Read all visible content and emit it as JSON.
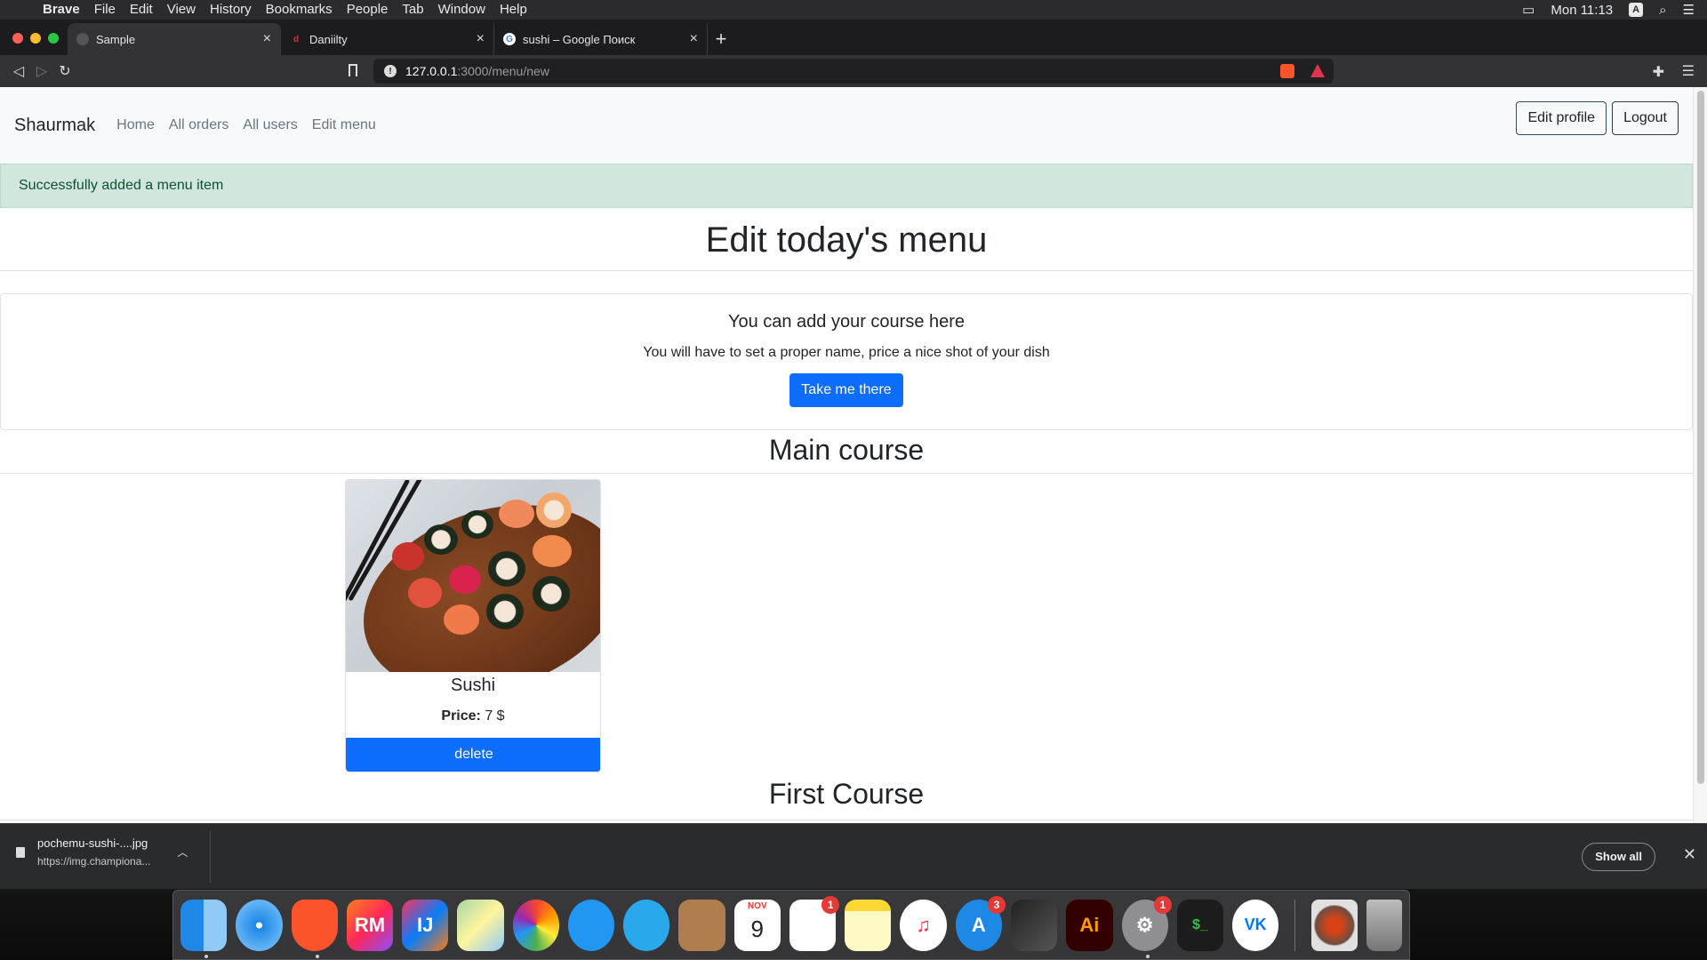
{
  "os_menu": {
    "app": "Brave",
    "items": [
      "File",
      "Edit",
      "View",
      "History",
      "Bookmarks",
      "People",
      "Tab",
      "Window",
      "Help"
    ],
    "clock": "Mon 11:13",
    "input_badge": "A"
  },
  "browser": {
    "tabs": [
      {
        "title": "Sample",
        "favicon": ""
      },
      {
        "title": "Daniilty",
        "favicon": "d"
      },
      {
        "title": "sushi – Google Поиск",
        "favicon": "G"
      }
    ],
    "url_host": "127.0.0.1",
    "url_path": ":3000/menu/new",
    "colors": {
      "shield": "#fb542b",
      "rewards": "#e2334a"
    }
  },
  "site": {
    "brand": "Shaurmak",
    "nav": [
      "Home",
      "All orders",
      "All users",
      "Edit menu"
    ],
    "edit_profile": "Edit profile",
    "logout": "Logout",
    "alert": "Successfully added a menu item",
    "title": "Edit today's menu",
    "jumbo": {
      "heading": "You can add your course here",
      "text": "You will have to set a proper name, price a nice shot of your dish",
      "button": "Take me there"
    },
    "sections": {
      "main": "Main course",
      "first": "First Course"
    },
    "card": {
      "name": "Sushi",
      "price_label": "Price:",
      "price_value": "7 $",
      "delete": "delete"
    },
    "colors": {
      "primary": "#0d6efd",
      "alert_bg": "#d1e7dd",
      "alert_text": "#0f5132"
    }
  },
  "downloads": {
    "file": "pochemu-sushi-....jpg",
    "url": "https://img.championa...",
    "show_all": "Show all"
  },
  "dock": {
    "apps": [
      {
        "name": "finder-icon",
        "label": ""
      },
      {
        "name": "safari-icon",
        "label": ""
      },
      {
        "name": "brave-icon",
        "label": ""
      },
      {
        "name": "rubymine-icon",
        "label": "RM"
      },
      {
        "name": "intellij-icon",
        "label": "IJ"
      },
      {
        "name": "maps-icon",
        "label": ""
      },
      {
        "name": "photos-icon",
        "label": ""
      },
      {
        "name": "messages-icon",
        "label": ""
      },
      {
        "name": "telegram-icon",
        "label": ""
      },
      {
        "name": "contacts-icon",
        "label": ""
      },
      {
        "name": "calendar-icon",
        "label": "9",
        "sub": "NOV"
      },
      {
        "name": "reminders-icon",
        "label": "",
        "badge": "1"
      },
      {
        "name": "notes-icon",
        "label": ""
      },
      {
        "name": "music-icon",
        "label": "♫"
      },
      {
        "name": "appstore-icon",
        "label": "A",
        "badge": "3"
      },
      {
        "name": "finalcut-icon",
        "label": ""
      },
      {
        "name": "illustrator-icon",
        "label": "Ai"
      },
      {
        "name": "system-preferences-icon",
        "label": "⚙",
        "badge": "1"
      },
      {
        "name": "terminal-icon",
        "label": "$_"
      },
      {
        "name": "vk-icon",
        "label": "VK"
      }
    ]
  }
}
